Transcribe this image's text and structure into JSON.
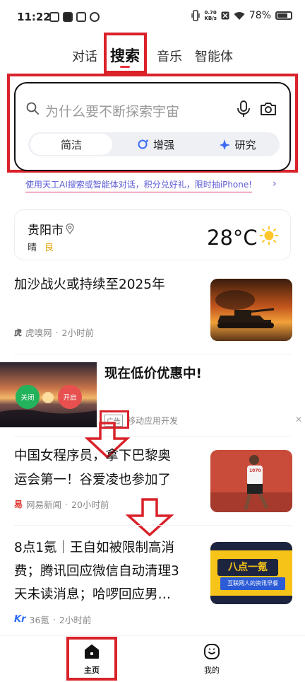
{
  "status_bar": {
    "time": "11:22",
    "net_speed_value": "0.70",
    "net_speed_unit": "KB/s",
    "battery": "78%",
    "icons": [
      "vibrate-icon",
      "network-speed",
      "x-icon",
      "wifi-icon",
      "battery-icon"
    ]
  },
  "tabs": [
    {
      "label": "对话",
      "active": false
    },
    {
      "label": "搜索",
      "active": true
    },
    {
      "label": "音乐",
      "active": false
    },
    {
      "label": "智能体",
      "active": false
    }
  ],
  "search": {
    "placeholder": "为什么要不断探索宇宙",
    "modes": [
      {
        "label": "简洁",
        "selected": true
      },
      {
        "label": "增强",
        "selected": false,
        "icon": "enhance-icon"
      },
      {
        "label": "研究",
        "selected": false,
        "icon": "sparkle-icon"
      }
    ]
  },
  "promo": {
    "text": "使用天工AI搜索或智能体对话，积分兑好礼，限时抽iPhone!",
    "arrow": "›"
  },
  "weather": {
    "city": "贵阳市",
    "condition": "晴",
    "air_quality": "良",
    "temperature": "28°C"
  },
  "feed": [
    {
      "title": "加沙战火或持续至2025年",
      "source": "虎嗅网",
      "time": "2小时前"
    },
    {
      "ad_title": "现在低价优惠中!",
      "ad_label": "广告",
      "source": "移动应用开发",
      "btn_close": "关闭",
      "btn_open": "开启"
    },
    {
      "title_line1": "中国女程序员，拿下巴黎奥",
      "title_line2": "运会第一！谷爱凌也参加了",
      "source": "网易新闻",
      "time": "20小时前"
    },
    {
      "title_line1": "8点1氪｜王自如被限制高消",
      "title_line2": "费；腾讯回应微信自动清理3",
      "title_line3": "天未读消息；哈啰回应男…",
      "source": "36氪",
      "time": "2小时前",
      "thumb_text": "八点一氪",
      "thumb_subtext": "互联网人的资讯早餐",
      "runner_bib": "1070"
    }
  ],
  "bottom_nav": [
    {
      "label": "主页",
      "active": true
    },
    {
      "label": "我的",
      "active": false
    }
  ],
  "colors": {
    "accent": "#e8333f",
    "annotation_red": "#d9222a",
    "promo": "#5b5bd6",
    "air_quality": "#e6a100"
  }
}
